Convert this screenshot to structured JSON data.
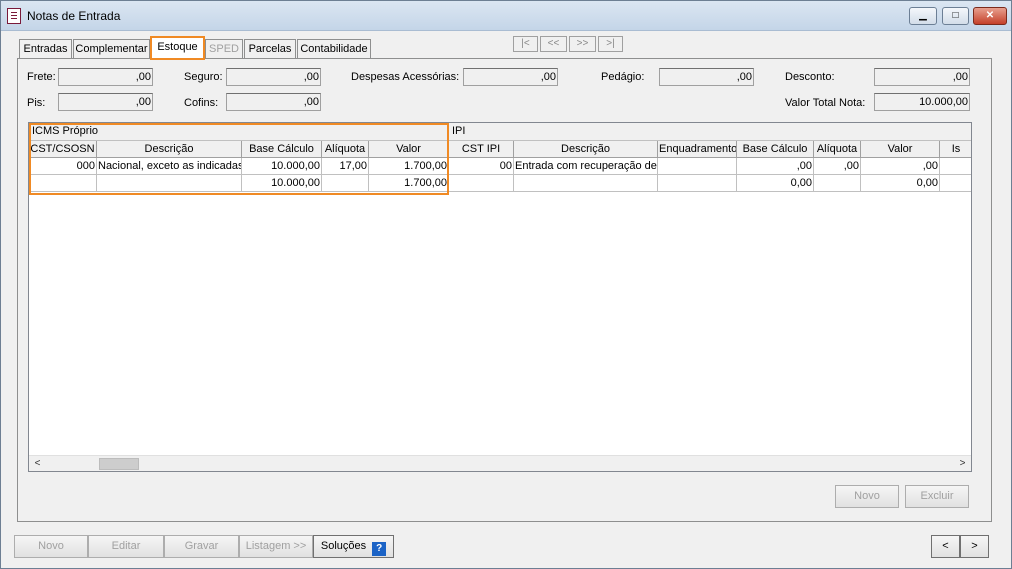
{
  "window": {
    "title": "Notas de Entrada",
    "min": "▁",
    "max": "□",
    "close": "✕"
  },
  "tabs": [
    {
      "label": "Entradas"
    },
    {
      "label": "Complementar"
    },
    {
      "label": "Estoque"
    },
    {
      "label": "SPED"
    },
    {
      "label": "Parcelas"
    },
    {
      "label": "Contabilidade"
    }
  ],
  "record_nav": {
    "first": "|<",
    "prev": "<<",
    "next": ">>",
    "last": ">|"
  },
  "fields": {
    "frete": {
      "label": "Frete:",
      "value": ",00"
    },
    "seguro": {
      "label": "Seguro:",
      "value": ",00"
    },
    "despesas": {
      "label": "Despesas Acessórias:",
      "value": ",00"
    },
    "pedagio": {
      "label": "Pedágio:",
      "value": ",00"
    },
    "desconto": {
      "label": "Desconto:",
      "value": ",00"
    },
    "pis": {
      "label": "Pis:",
      "value": ",00"
    },
    "cofins": {
      "label": "Cofins:",
      "value": ",00"
    },
    "valor_total": {
      "label": "Valor Total Nota:",
      "value": "10.000,00"
    }
  },
  "grid": {
    "icms_band": "ICMS Próprio",
    "ipi_band": "IPI",
    "headers": {
      "cst_csosn": "CST/CSOSN",
      "descricao": "Descrição",
      "base_calculo": "Base Cálculo",
      "aliquota": "Alíquota",
      "valor": "Valor",
      "cst_ipi": "CST IPI",
      "ipi_descricao": "Descrição",
      "enquadramento": "Enquadramento",
      "ipi_base": "Base Cálculo",
      "ipi_aliquota": "Alíquota",
      "ipi_valor": "Valor",
      "isento": "Is"
    },
    "row1": {
      "cst_csosn": "000",
      "descricao": "Nacional, exceto as indicadas",
      "base_calculo": "10.000,00",
      "aliquota": "17,00",
      "valor": "1.700,00",
      "cst_ipi": "00",
      "ipi_descricao": "Entrada com recuperação de",
      "enquadramento": "",
      "ipi_base": ",00",
      "ipi_aliquota": ",00",
      "ipi_valor": ",00"
    },
    "totals": {
      "base_calculo": "10.000,00",
      "valor": "1.700,00",
      "ipi_base": "0,00",
      "ipi_valor": "0,00"
    }
  },
  "scroll": {
    "left": "<",
    "right": ">"
  },
  "panel_buttons": {
    "novo": "Novo",
    "excluir": "Excluir"
  },
  "bottom_buttons": {
    "novo": "Novo",
    "editar": "Editar",
    "gravar": "Gravar",
    "listagem": "Listagem >>",
    "solucoes": "Soluções",
    "help": "?",
    "prev": "<",
    "next": ">"
  },
  "colors": {
    "highlight": "#f08a24",
    "help_icon": "#1b63c6"
  }
}
